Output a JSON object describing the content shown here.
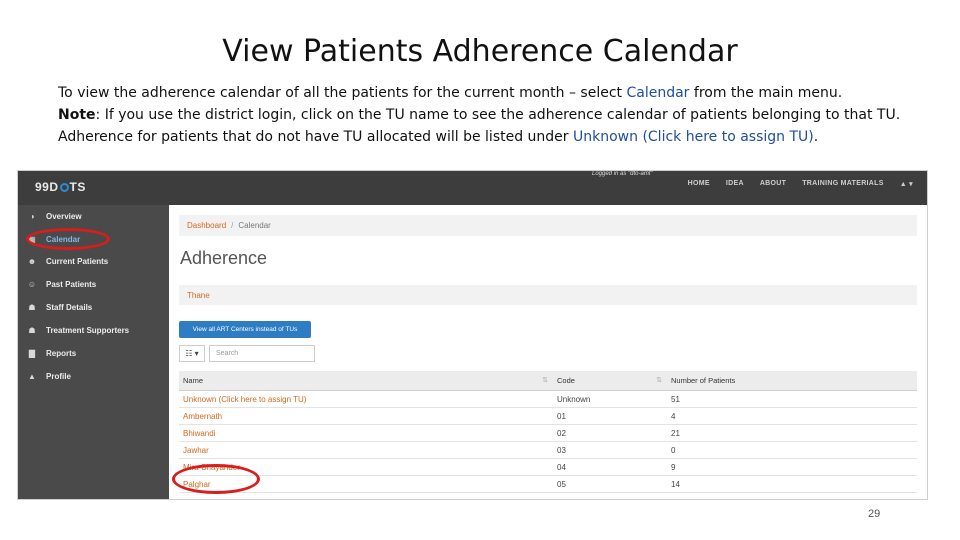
{
  "slide": {
    "title": "View Patients Adherence Calendar",
    "intro_line1_a": "To view the adherence calendar of all the patients for the current month – select ",
    "intro_line1_calendar": "Calendar",
    "intro_line1_b": " from the main menu.",
    "note_label": "Note",
    "note_text": ": If you use the district login, click on the TU name to see the adherence calendar of patients belonging to that TU. Adherence for patients that do not have TU allocated will be listed under ",
    "note_link": "Unknown (Click here to assign TU)",
    "note_end": ".",
    "page_number": "29"
  },
  "app": {
    "logo_a": "99D",
    "logo_b": "TS",
    "logged_in": "Logged in as \"dto-amt\"",
    "nav": [
      "HOME",
      "IDEA",
      "ABOUT",
      "TRAINING MATERIALS",
      "▲ ▾"
    ],
    "sidebar": [
      {
        "label": "Overview",
        "icon": "dashboard-icon",
        "glyph": "◑"
      },
      {
        "label": "Calendar",
        "icon": "calendar-icon",
        "glyph": "▦"
      },
      {
        "label": "Current Patients",
        "icon": "users-icon",
        "glyph": "☻"
      },
      {
        "label": "Past Patients",
        "icon": "user-times-icon",
        "glyph": "☺"
      },
      {
        "label": "Staff Details",
        "icon": "staff-icon",
        "glyph": "☗"
      },
      {
        "label": "Treatment Supporters",
        "icon": "supporters-icon",
        "glyph": "☗"
      },
      {
        "label": "Reports",
        "icon": "chart-icon",
        "glyph": "▇"
      },
      {
        "label": "Profile",
        "icon": "user-icon",
        "glyph": "▲"
      }
    ],
    "breadcrumb": {
      "root": "Dashboard",
      "sep": "/",
      "current": "Calendar"
    },
    "heading": "Adherence",
    "tu_name": "Thane",
    "art_button": "View all ART Centers instead of TUs",
    "columns_button": "☷ ▾",
    "search_placeholder": "Search",
    "table": {
      "headers": [
        "Name",
        "Code",
        "Number of Patients"
      ],
      "sort_glyph": "⇅",
      "rows": [
        [
          "Unknown (Click here to assign TU)",
          "Unknown",
          "51"
        ],
        [
          "Ambernath",
          "01",
          "4"
        ],
        [
          "Bhiwandi",
          "02",
          "21"
        ],
        [
          "Jawhar",
          "03",
          "0"
        ],
        [
          "Mira-Bhayander",
          "04",
          "9"
        ],
        [
          "Palghar",
          "05",
          "14"
        ]
      ]
    }
  }
}
